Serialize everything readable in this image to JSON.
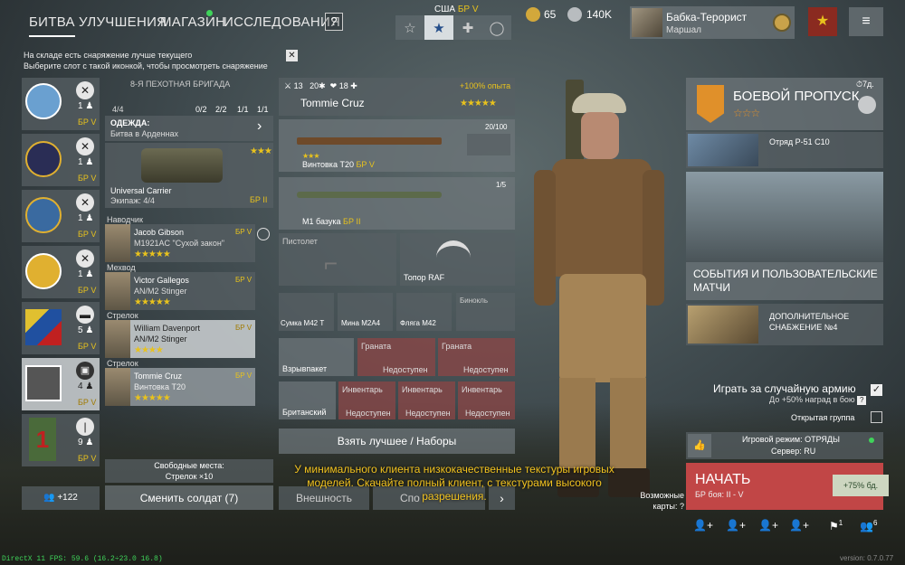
{
  "nav": {
    "battle": "БИТВА",
    "upgrades": "УЛУЧШЕНИЯ",
    "shop": "МАГАЗИН",
    "research": "ИССЛЕДОВАНИЯ",
    "help": "?"
  },
  "nation": {
    "label": "США",
    "br": "БР V"
  },
  "currency": {
    "gold": "65",
    "silver": "140K"
  },
  "profile": {
    "name": "Бабка-Терорист",
    "rank": "Маршал"
  },
  "notice": {
    "line1": "На складе есть снаряжение лучше текущего",
    "line2": "Выберите слот с такой иконкой, чтобы просмотреть снаряжение"
  },
  "squads": [
    {
      "count": "1",
      "br": "БР V"
    },
    {
      "count": "1",
      "br": "БР V"
    },
    {
      "count": "1",
      "br": "БР V"
    },
    {
      "count": "1",
      "br": "БР V"
    },
    {
      "count": "5",
      "br": "БР V"
    },
    {
      "count": "4",
      "br": "БР V"
    },
    {
      "count": "9",
      "br": "БР V"
    }
  ],
  "squad_add": "+122",
  "brigade": {
    "name": "8-Я ПЕХОТНАЯ БРИГАДА",
    "size": "4/4",
    "slots": [
      "0/2",
      "2/2",
      "1/1",
      "1/1"
    ],
    "uniform_title": "ОДЕЖДА:",
    "uniform_value": "Битва в Арденнах",
    "vehicle_name": "Universal Carrier",
    "vehicle_crew": "Экипаж: 4/4",
    "vehicle_br": "БР II"
  },
  "soldiers": [
    {
      "role": "Наводчик",
      "name": "Jacob Gibson",
      "weapon": "M1921AC \"Сухой закон\"",
      "br": "БР V",
      "stars": "★★★★★"
    },
    {
      "role": "Мехвод",
      "name": "Victor Gallegos",
      "weapon": "AN/M2 Stinger",
      "br": "БР V",
      "stars": "★★★★★"
    },
    {
      "role": "Стрелок",
      "name": "William Davenport",
      "weapon": "AN/M2 Stinger",
      "br": "БР V",
      "stars": "★★★★"
    },
    {
      "role": "Стрелок",
      "name": "Tommie Cruz",
      "weapon": "Винтовка Т20",
      "br": "БР V",
      "stars": "★★★★★"
    }
  ],
  "free_slots": {
    "line1": "Свободные места:",
    "line2": "Стрелок ×10"
  },
  "change_soldier": "Сменить солдат (7)",
  "selected": {
    "level": "13",
    "stat1": "20",
    "stat2": "18",
    "exp_bonus": "+100% опыта",
    "name": "Tommie Cruz",
    "stars": "★★★★★"
  },
  "equipment": {
    "primary": {
      "name": "Винтовка Т20",
      "br": "БР V",
      "ammo": "20/100",
      "stars": "★★★"
    },
    "secondary": {
      "name": "M1 базука",
      "br": "БР II",
      "ammo": "1/5"
    },
    "pistol": "Пистолет",
    "melee": "Топор RAF",
    "bag": "Сумка М42 Т",
    "mine": "Мина М2А4",
    "flask": "Фляга М42",
    "binoculars": "Бинокль",
    "explosive": "Взрывпакет",
    "grenade_label": "Граната",
    "unavailable": "Недоступен",
    "backpack": "Британский",
    "inventory_label": "Инвентарь"
  },
  "take_best": "Взять лучшее / Наборы",
  "appearance_tab": "Внешность",
  "other_tab": "Спо",
  "warning": "У минимального клиента низкокачественные текстуры игровых моделей. Скачайте полный клиент, с текстурами высокого разрешения.",
  "battle_pass": {
    "title": "БОЕВОЙ ПРОПУСК",
    "time": "7д.",
    "reward": "Отряд P-51 C10"
  },
  "events_title": "СОБЫТИЯ И ПОЛЬЗОВАТЕЛЬСКИЕ МАТЧИ",
  "supply": "ДОПОЛНИТЕЛЬНОЕ СНАБЖЕНИЕ №4",
  "random_army": {
    "label": "Играть за случайную армию",
    "sub": "До +50% наград в бою"
  },
  "open_group": "Открытая группа",
  "game_mode": {
    "mode": "Игровой режим: ОТРЯДЫ",
    "server": "Сервер: RU"
  },
  "start": {
    "label": "НАЧАТЬ",
    "br": "БР боя: II - V",
    "bonus": "+75% бд."
  },
  "possible_maps": {
    "line1": "Возможные",
    "line2": "карты:"
  },
  "party_counts": {
    "flag": "1",
    "group": "6"
  },
  "fps": "DirectX 11 FPS: 59.6 (16.2÷23.0 16.8)",
  "version": "version: 0.7.0.77",
  "colors": {
    "accent": "#e8c21d",
    "start": "#c14646",
    "positive": "#3fd35a"
  }
}
